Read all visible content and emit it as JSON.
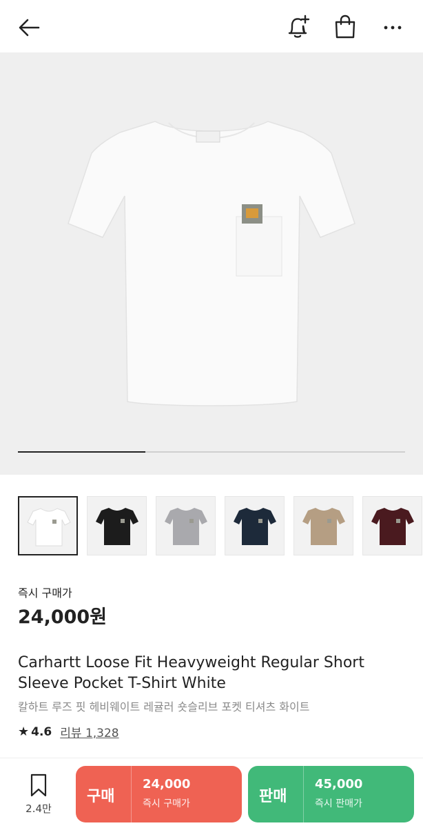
{
  "header": {
    "back_icon": "arrow-left-icon",
    "alert_icon": "bell-plus-icon",
    "bag_icon": "shopping-bag-icon",
    "more_icon": "more-horizontal-icon"
  },
  "gallery": {
    "progress": 0.33,
    "thumbnails": [
      {
        "color_name": "White",
        "color": "#ffffff"
      },
      {
        "color_name": "Black",
        "color": "#1c1c1c"
      },
      {
        "color_name": "Grey",
        "color": "#a9a9ad"
      },
      {
        "color_name": "Navy",
        "color": "#1d2a3a"
      },
      {
        "color_name": "Tan",
        "color": "#b59e83"
      },
      {
        "color_name": "Burgundy",
        "color": "#4a1a1f"
      }
    ]
  },
  "price": {
    "label": "즉시 구매가",
    "value": "24,000원"
  },
  "product": {
    "title": "Carhartt Loose Fit Heavyweight Regular Short Sleeve Pocket T-Shirt White",
    "subtitle": "칼하트 루즈 핏 헤비웨이트 레귤러 숏슬리브 포켓 티셔츠 화이트",
    "rating": "4.6",
    "reviews": "리뷰 1,328"
  },
  "bottom": {
    "wish_count": "2.4만",
    "buy": {
      "label": "구매",
      "price": "24,000",
      "sub": "즉시 구매가",
      "color": "#ef6253"
    },
    "sell": {
      "label": "판매",
      "price": "45,000",
      "sub": "즉시 판매가",
      "color": "#41b979"
    }
  }
}
